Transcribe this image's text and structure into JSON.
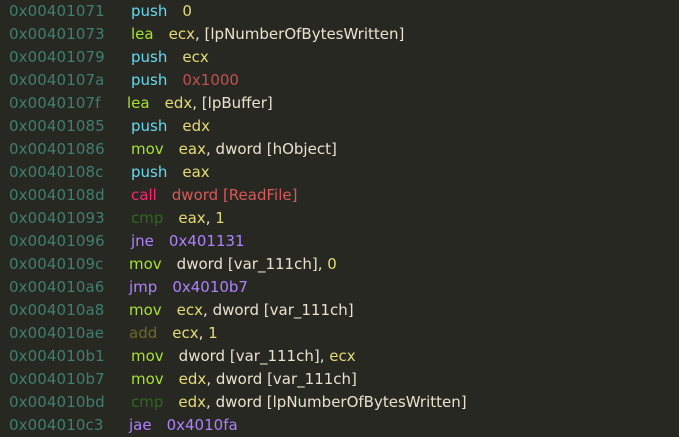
{
  "colors": {
    "background": "#272822",
    "address": "#3f7f6e",
    "push": "#66d9ef",
    "lea": "#a6e22e",
    "mov": "#a6e22e",
    "call": "#f92672",
    "cmp": "#2d6a1f",
    "jcc": "#ae81ff",
    "add": "#6b6a2a",
    "register": "#e6db74",
    "text": "#e6e3cf",
    "hex_immediate": "#c2504f",
    "call_target": "#d75a5a",
    "jump_target": "#ae81ff"
  },
  "lines": [
    {
      "address": "0x00401071",
      "mnemonic": "push",
      "operands": "0"
    },
    {
      "address": "0x00401073",
      "mnemonic": "lea",
      "operands": "ecx, [lpNumberOfBytesWritten]"
    },
    {
      "address": "0x00401079",
      "mnemonic": "push",
      "operands": "ecx"
    },
    {
      "address": "0x0040107a",
      "mnemonic": "push",
      "operands": "0x1000"
    },
    {
      "address": "0x0040107f",
      "mnemonic": "lea",
      "operands": "edx, [lpBuffer]"
    },
    {
      "address": "0x00401085",
      "mnemonic": "push",
      "operands": "edx"
    },
    {
      "address": "0x00401086",
      "mnemonic": "mov",
      "operands": "eax, dword [hObject]"
    },
    {
      "address": "0x0040108c",
      "mnemonic": "push",
      "operands": "eax"
    },
    {
      "address": "0x0040108d",
      "mnemonic": "call",
      "operands": "dword [ReadFile]"
    },
    {
      "address": "0x00401093",
      "mnemonic": "cmp",
      "operands": "eax, 1"
    },
    {
      "address": "0x00401096",
      "mnemonic": "jne",
      "operands": "0x401131"
    },
    {
      "address": "0x0040109c",
      "mnemonic": "mov",
      "operands": "dword [var_111ch], 0"
    },
    {
      "address": "0x004010a6",
      "mnemonic": "jmp",
      "operands": "0x4010b7"
    },
    {
      "address": "0x004010a8",
      "mnemonic": "mov",
      "operands": "ecx, dword [var_111ch]"
    },
    {
      "address": "0x004010ae",
      "mnemonic": "add",
      "operands": "ecx, 1"
    },
    {
      "address": "0x004010b1",
      "mnemonic": "mov",
      "operands": "dword [var_111ch], ecx"
    },
    {
      "address": "0x004010b7",
      "mnemonic": "mov",
      "operands": "edx, dword [var_111ch]"
    },
    {
      "address": "0x004010bd",
      "mnemonic": "cmp",
      "operands": "edx, dword [lpNumberOfBytesWritten]"
    },
    {
      "address": "0x004010c3",
      "mnemonic": "jae",
      "operands": "0x4010fa"
    }
  ]
}
